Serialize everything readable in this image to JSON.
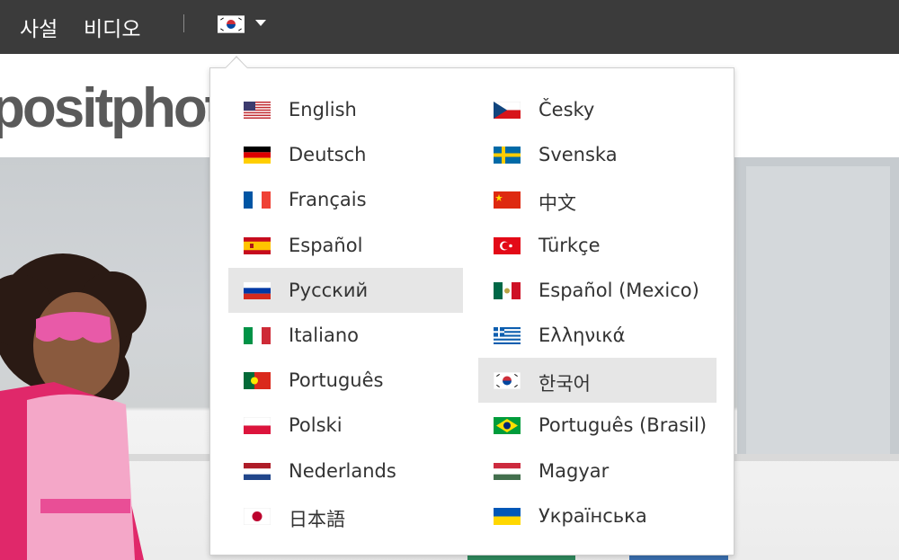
{
  "topbar": {
    "nav_links": [
      "사설",
      "비디오"
    ],
    "selected_language_flag": "kr"
  },
  "background": {
    "logo_text": "positphoto"
  },
  "language_menu": {
    "left_column": [
      {
        "label": "English",
        "flag": "us"
      },
      {
        "label": "Deutsch",
        "flag": "de"
      },
      {
        "label": "Français",
        "flag": "fr"
      },
      {
        "label": "Español",
        "flag": "es"
      },
      {
        "label": "Русский",
        "flag": "ru",
        "highlighted": true
      },
      {
        "label": "Italiano",
        "flag": "it"
      },
      {
        "label": "Português",
        "flag": "pt"
      },
      {
        "label": "Polski",
        "flag": "pl"
      },
      {
        "label": "Nederlands",
        "flag": "nl"
      },
      {
        "label": "日本語",
        "flag": "jp"
      }
    ],
    "right_column": [
      {
        "label": "Česky",
        "flag": "cz"
      },
      {
        "label": "Svenska",
        "flag": "se"
      },
      {
        "label": "中文",
        "flag": "cn"
      },
      {
        "label": "Türkçe",
        "flag": "tr"
      },
      {
        "label": "Español (Mexico)",
        "flag": "mx"
      },
      {
        "label": "Ελληνικά",
        "flag": "gr"
      },
      {
        "label": "한국어",
        "flag": "kr",
        "highlighted": true
      },
      {
        "label": "Português (Brasil)",
        "flag": "br"
      },
      {
        "label": "Magyar",
        "flag": "hu"
      },
      {
        "label": "Українська",
        "flag": "ua"
      }
    ]
  },
  "colors": {
    "topbar_bg": "#3b3b3b",
    "highlight_bg": "#e6e6e6"
  }
}
